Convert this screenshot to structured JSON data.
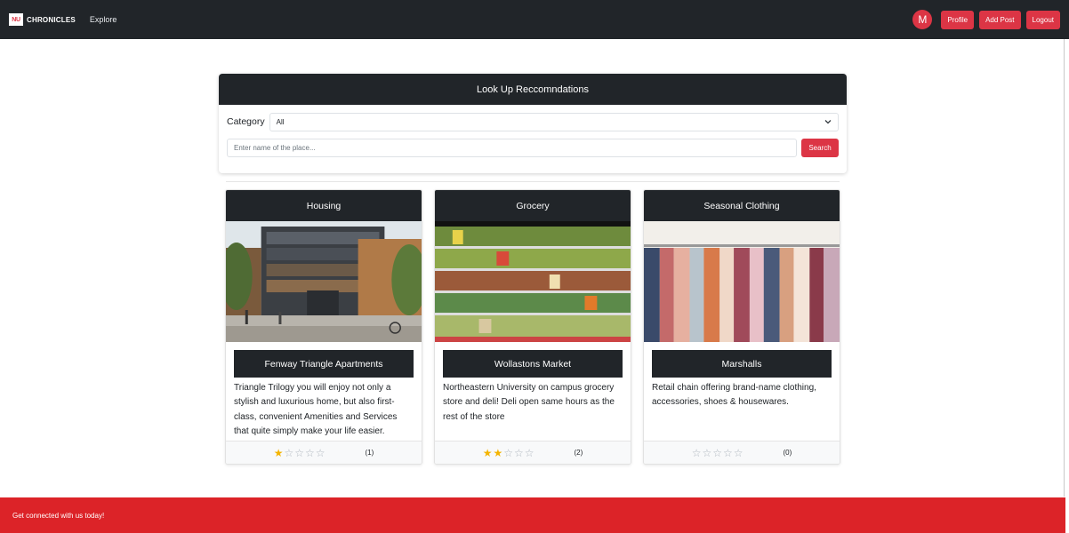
{
  "nav": {
    "brand_logo": "NU",
    "brand_name": "CHRONICLES",
    "explore": "Explore",
    "avatar_initial": "M",
    "profile": "Profile",
    "add_post": "Add Post",
    "logout": "Logout"
  },
  "search": {
    "title": "Look Up Reccomndations",
    "category_label": "Category",
    "category_value": "All",
    "input_placeholder": "Enter name of the place...",
    "button": "Search"
  },
  "cards": [
    {
      "category": "Housing",
      "place": "Fenway Triangle Apartments",
      "description": "Triangle Trilogy you will enjoy not only a stylish and luxurious home, but also first-class, convenient Amenities and Services that quite simply make your life easier.",
      "rating": 1,
      "count": "(1)"
    },
    {
      "category": "Grocery",
      "place": "Wollastons Market",
      "description": "Northeastern University on campus grocery store and deli! Deli open same hours as the rest of the store",
      "rating": 2,
      "count": "(2)"
    },
    {
      "category": "Seasonal Clothing",
      "place": "Marshalls",
      "description": "Retail chain offering brand-name clothing, accessories, shoes & housewares.",
      "rating": 0,
      "count": "(0)"
    }
  ],
  "footer": {
    "text": "Get connected with us today!"
  },
  "colors": {
    "navbar": "#212529",
    "accent": "#dc3545",
    "footer": "#dc2328",
    "star": "#f4b400"
  }
}
